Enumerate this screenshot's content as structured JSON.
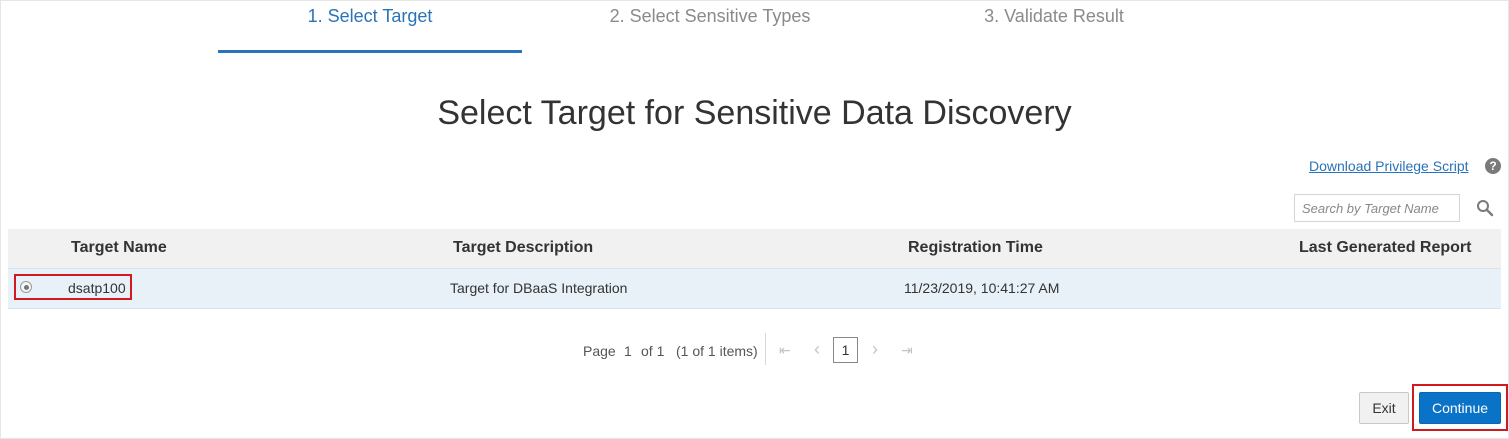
{
  "steps": [
    {
      "label": "1. Select Target",
      "active": true
    },
    {
      "label": "2. Select Sensitive Types",
      "active": false
    },
    {
      "label": "3. Validate Result",
      "active": false
    }
  ],
  "page_title": "Select Target for Sensitive Data Discovery",
  "download_link": "Download Privilege Script",
  "help_icon_glyph": "?",
  "search": {
    "placeholder": "Search by Target Name",
    "value": ""
  },
  "table": {
    "columns": [
      "Target Name",
      "Target Description",
      "Registration Time",
      "Last Generated Report"
    ],
    "rows": [
      {
        "selected": true,
        "target_name": "dsatp100",
        "description": "Target for DBaaS Integration",
        "registration_time": "11/23/2019, 10:41:27 AM",
        "last_report": ""
      }
    ]
  },
  "pagination": {
    "page_label": "Page",
    "page": "1",
    "of_label": "of 1",
    "items_label": "(1 of 1 items)",
    "current": "1",
    "first_glyph": "⇤",
    "prev_glyph": "‹",
    "next_glyph": "›",
    "last_glyph": "⇥"
  },
  "buttons": {
    "exit": "Exit",
    "continue": "Continue"
  },
  "colors": {
    "accent": "#2a73b8",
    "primary_button": "#0b73c7",
    "highlight_box": "#d2191f",
    "selected_row": "#e8f1f8"
  }
}
